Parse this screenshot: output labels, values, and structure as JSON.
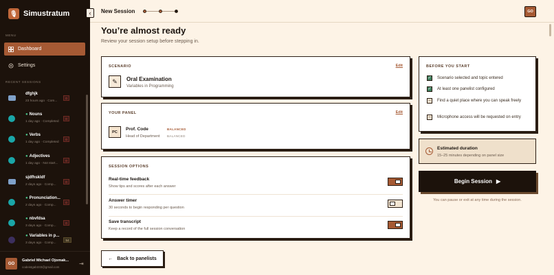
{
  "app": {
    "name": "Simustratum",
    "logo": "mic-icon"
  },
  "sidebar": {
    "menu_label": "MENU",
    "nav": [
      {
        "label": "Dashboard",
        "icon": "grid-icon",
        "active": true
      },
      {
        "label": "Settings",
        "icon": "gear-icon",
        "active": false
      }
    ],
    "recent_label": "RECENT SESSIONS",
    "sessions": [
      {
        "title": "dfghjk",
        "meta": "23 hours ago · Com...",
        "icon": "chat-icon",
        "badge": "0"
      },
      {
        "title": "Nouns",
        "meta": "1 day ago · Completed",
        "icon": "globe-icon",
        "badge": "0",
        "dot": true
      },
      {
        "title": "Verbs",
        "meta": "1 day ago · Completed",
        "icon": "globe-icon",
        "badge": "0",
        "dot": true
      },
      {
        "title": "Adjectives",
        "meta": "1 day ago · Not start...",
        "icon": "globe-icon",
        "badge": "0",
        "dot": true
      },
      {
        "title": "sjdfhskldf",
        "meta": "2 days ago · Comp...",
        "icon": "chat-icon",
        "badge": "0"
      },
      {
        "title": "Pronunciation...",
        "meta": "2 days ago · Comp...",
        "icon": "globe-icon",
        "badge": "0",
        "dot": true
      },
      {
        "title": "nbvfdsa",
        "meta": "3 days ago · Comp...",
        "icon": "globe-icon",
        "badge": "0",
        "dot": true
      },
      {
        "title": "Variables in p...",
        "meta": "3 days ago · Comp...",
        "icon": "moon-icon",
        "badge": "54",
        "dot": true
      }
    ],
    "user": {
      "initials": "GO",
      "name": "Gabriel Michael Ojomak...",
      "email": "codeistgab333@gmail.com"
    }
  },
  "header": {
    "title": "New Session",
    "avatar": "GO"
  },
  "main": {
    "title": "You’re almost ready",
    "subtitle": "Review your session setup before stepping in.",
    "scenario": {
      "label": "SCENARIO",
      "edit": "Edit",
      "title": "Oral Examination",
      "sub": "Variables in Programming"
    },
    "panel": {
      "label": "YOUR PANEL",
      "edit": "Edit",
      "initials": "PC",
      "name": "Prof. Code",
      "role": "Head of Department",
      "tag1": "BALANCED",
      "tag2": "BALANCED"
    },
    "options": {
      "label": "SESSION OPTIONS",
      "items": [
        {
          "title": "Real-time feedback",
          "desc": "Show tips and scores after each answer",
          "on": true
        },
        {
          "title": "Answer timer",
          "desc": "30 seconds to begin responding per question",
          "on": false
        },
        {
          "title": "Save transcript",
          "desc": "Keep a record of the full session conversation",
          "on": true
        }
      ]
    },
    "back_label": "Back to panelists"
  },
  "right": {
    "before_label": "BEFORE YOU START",
    "checklist": [
      {
        "text": "Scenario selected and topic entered",
        "done": true
      },
      {
        "text": "At least one panelist configured",
        "done": true
      },
      {
        "text": "Find a quiet place where you can speak freely",
        "done": false
      },
      {
        "text": "Microphone access will be requested on entry",
        "done": false
      }
    ],
    "duration_title": "Estimated duration",
    "duration_sub": "15–25 minutes depending on panel size",
    "begin_label": "Begin Session",
    "begin_note": "You can pause or exit at any time during the session."
  }
}
